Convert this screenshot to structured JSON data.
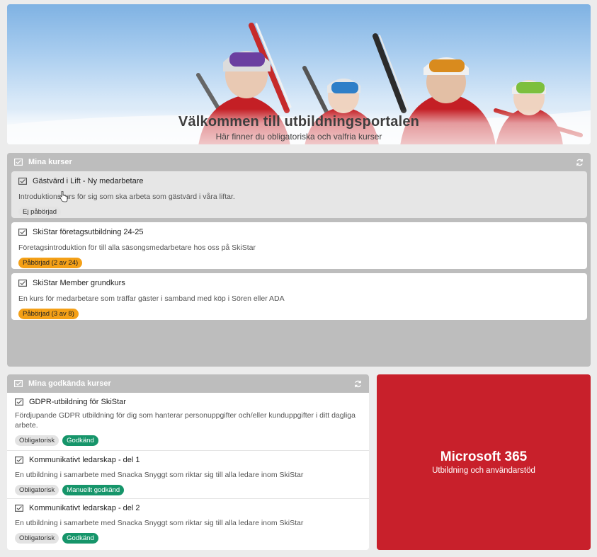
{
  "hero": {
    "title": "Välkommen till utbildningsportalen",
    "subtitle": "Här finner du obligatoriska och valfria kurser"
  },
  "my_courses": {
    "header": "Mina kurser",
    "header_icon": "course-icon",
    "refresh_icon": "refresh-icon",
    "items": [
      {
        "title": "Gästvärd i Lift - Ny medarbetare",
        "description": "Introduktionskurs för sig som ska arbeta som gästvärd i våra liftar.",
        "status": "Ej påbörjad",
        "status_color": "#e3e3e3"
      },
      {
        "title": "SkiStar företagsutbildning 24-25",
        "description": "Företagsintroduktion för till alla säsongsmedarbetare hos oss på SkiStar",
        "status": "Påbörjad (2 av 24)",
        "status_color": "#f4a017"
      },
      {
        "title": "SkiStar Member grundkurs",
        "description": "En kurs för medarbetare som träffar gäster i samband med köp i Sören eller ADA",
        "status": "Påbörjad (3 av 8)",
        "status_color": "#f4a017"
      }
    ]
  },
  "approved_courses": {
    "header": "Mina godkända kurser",
    "items": [
      {
        "title": "GDPR-utbildning för SkiStar",
        "description": "Fördjupande GDPR utbildning för dig som hanterar personuppgifter och/eller kunduppgifter i ditt dagliga arbete.",
        "tag": "Obligatorisk",
        "status": "Godkänd"
      },
      {
        "title": "Kommunikativt ledarskap - del 1",
        "description": "En utbildning i samarbete med Snacka Snyggt som riktar sig till alla ledare inom SkiStar",
        "tag": "Obligatorisk",
        "status": "Manuellt godkänd"
      },
      {
        "title": "Kommunikativt ledarskap - del 2",
        "description": "En utbildning i samarbete med Snacka Snyggt som riktar sig till alla ledare inom SkiStar",
        "tag": "Obligatorisk",
        "status": "Godkänd"
      }
    ],
    "status_color": "#16956a"
  },
  "microsoft": {
    "title": "Microsoft 365",
    "subtitle": "Utbildning och användarstöd",
    "color": "#c8202b"
  }
}
